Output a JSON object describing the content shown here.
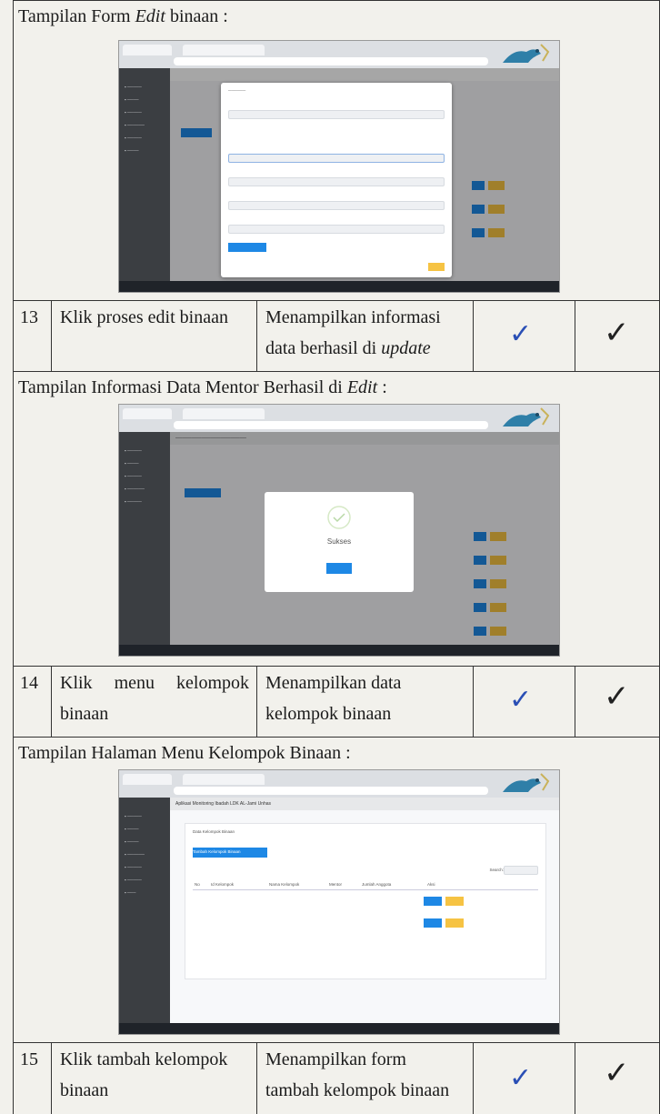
{
  "captions": {
    "c1": "Tampilan Form Edit binaan :",
    "c1_plain": "Tampilan Form ",
    "c1_italic": "Edit",
    "c1_tail": " binaan :",
    "c2_plain": "Tampilan Informasi Data Mentor Berhasil di ",
    "c2_italic": "Edit",
    "c2_tail": " :",
    "c3": "Tampilan Halaman Menu Kelompok Binaan :"
  },
  "rows": [
    {
      "no": "13",
      "action": "Klik proses edit binaan",
      "result_line1": "Menampilkan informasi",
      "result_line2_plain": "data berhasil di ",
      "result_line2_italic": "update"
    },
    {
      "no": "14",
      "action_line1": "Klik menu kelompok",
      "action_line2": "binaan",
      "result_line1": "Menampilkan data",
      "result_line2": "kelompok binaan"
    },
    {
      "no": "15",
      "action_line1": "Klik tambah kelompok",
      "action_line2": "binaan",
      "result_line1": "Menampilkan form",
      "result_line2": "tambah kelompok binaan"
    }
  ],
  "checks": {
    "expected": "✓",
    "actual": "✓"
  },
  "screenshot3": {
    "app_title": "Aplikasi Monitoring Ibadah LDK AL-Jami Unhas",
    "panel_title": "Data Kelompok Binaan",
    "add_button": "Tambah Kelompok Binaan",
    "search_label": "Search:",
    "columns": [
      "No",
      "Id Kelompok",
      "Nama Kelompok",
      "Mentor",
      "Jumlah Anggota",
      "Aksi"
    ]
  },
  "screenshot2": {
    "dialog_text": "Sukses"
  },
  "colors": {
    "blue": "#1e88e5",
    "yellow": "#f6c343",
    "sidebar": "#3b3e42",
    "check_blue": "#2a4fb5"
  }
}
